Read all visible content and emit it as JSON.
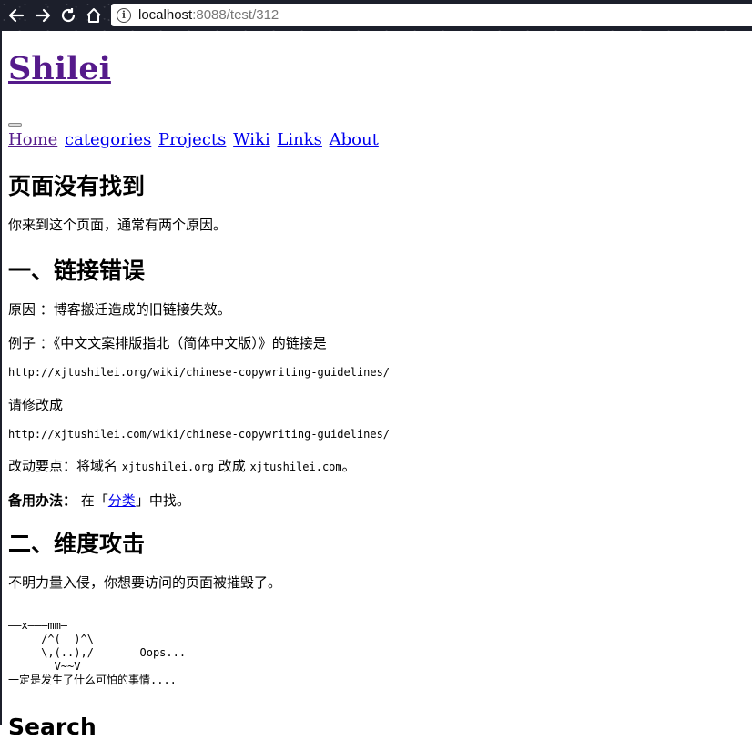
{
  "browser": {
    "url_host": "localhost",
    "url_rest": ":8088/test/312",
    "info_glyph": "i",
    "icons": [
      "back-icon",
      "forward-icon",
      "reload-icon",
      "home-icon",
      "info-icon"
    ]
  },
  "site": {
    "title": "Shilei",
    "nav": [
      "Home",
      "categories",
      "Projects",
      "Wiki",
      "Links",
      "About"
    ]
  },
  "page": {
    "heading": "页面没有找到",
    "intro": "你来到这个页面，通常有两个原因。",
    "section1": {
      "heading": "一、链接错误",
      "reason": "原因 ：博客搬迁造成的旧链接失效。",
      "example": "例子 ：《中文文案排版指北（简体中文版）》的链接是",
      "old_url": "http://xjtushilei.org/wiki/chinese-copywriting-guidelines/",
      "fix_label": "请修改成",
      "new_url": "http://xjtushilei.com/wiki/chinese-copywriting-guidelines/",
      "change_prefix": "改动要点：将域名 ",
      "old_domain": "xjtushilei.org",
      "change_mid": " 改成 ",
      "new_domain": "xjtushilei.com",
      "change_suffix": "。",
      "backup_label": "备用办法：",
      "backup_prefix": " 在「",
      "backup_link": "分类",
      "backup_suffix": "」中找。"
    },
    "section2": {
      "heading": "二、维度攻击",
      "text": "不明力量入侵，你想要访问的页面被摧毁了。",
      "ascii_art": "——x———mm—\n     /^(  )^\\\n     \\,(..),/       Oops...\n       V~~V\n一定是发生了什么可怕的事情....",
      "next_heading": "Search"
    }
  }
}
